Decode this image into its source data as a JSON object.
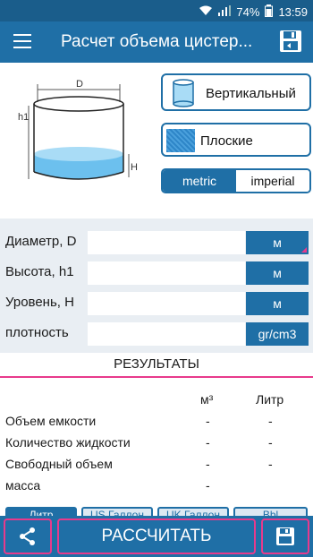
{
  "status_bar": {
    "battery": "74%",
    "time": "13:59"
  },
  "toolbar": {
    "title": "Расчет объема цистер...",
    "menu_icon": "hamburger-menu-icon",
    "save_icon": "save-floppy-icon"
  },
  "diagram": {
    "label_d": "D",
    "label_h1": "h1",
    "label_h": "H"
  },
  "orientation": {
    "vertical_label": "Вертикальный",
    "flat_label": "Плоские"
  },
  "units": {
    "metric": "metric",
    "imperial": "imperial",
    "selected": "metric"
  },
  "inputs": [
    {
      "label": "Диаметр, D",
      "value": "",
      "unit": "м"
    },
    {
      "label": "Высота, h1",
      "value": "",
      "unit": "м"
    },
    {
      "label": "Уровень, H",
      "value": "",
      "unit": "м"
    },
    {
      "label": "плотность",
      "value": "",
      "unit": "gr/cm3"
    }
  ],
  "results": {
    "title": "РЕЗУЛЬТАТЫ",
    "col1": "м³",
    "col2": "Литр",
    "rows": [
      {
        "label": "Объем емкости",
        "v1": "-",
        "v2": "-"
      },
      {
        "label": "Количество жидкости",
        "v1": "-",
        "v2": "-"
      },
      {
        "label": "Свободный объем",
        "v1": "-",
        "v2": "-"
      },
      {
        "label": "масса",
        "v1": "-",
        "v2": ""
      }
    ]
  },
  "unit_tabs": [
    "Литр",
    "US Галлон",
    "UK Галлон",
    "Bbl"
  ],
  "bottom": {
    "calculate": "РАССЧИТАТЬ",
    "share_icon": "share-icon",
    "save_icon": "save-icon"
  },
  "colors": {
    "primary": "#1f6fa6",
    "accent": "#e83a8c",
    "liquid": "#6cc0ee"
  }
}
